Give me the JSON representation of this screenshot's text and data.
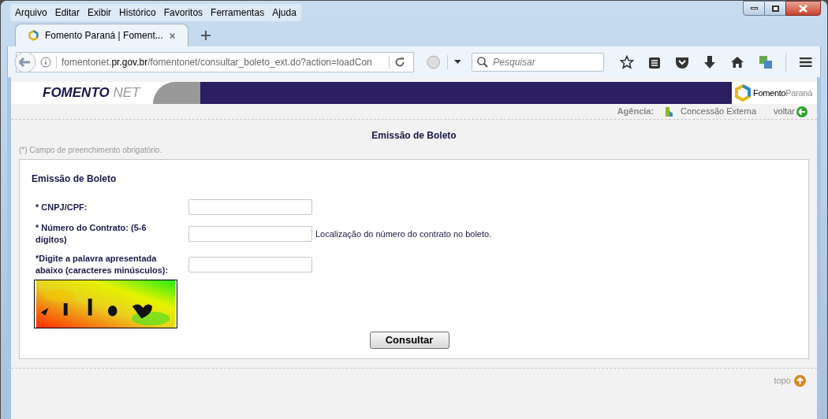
{
  "browser": {
    "menu": [
      "Arquivo",
      "Editar",
      "Exibir",
      "Histórico",
      "Favoritos",
      "Ferramentas",
      "Ajuda"
    ],
    "tab": {
      "title": "Fomento Paraná | Foment...",
      "selected": true
    },
    "url": {
      "host_prefix": "fomentonet.",
      "host": "pr.gov.br",
      "path": "/fomentonet/consultar_boleto_ext.do?action=loadCon"
    },
    "search": {
      "placeholder": "Pesquisar"
    }
  },
  "header": {
    "logo_main": "FOMENTO",
    "logo_sub": "NET",
    "brand_main": "Fomento",
    "brand_sub": "Paraná"
  },
  "agency": {
    "label": "Agência:",
    "value": "Concessão Externa",
    "back": "voltar"
  },
  "page_title": "Emissão de Boleto",
  "required_note": "(*) Campo de preenchimento obrigatório.",
  "form": {
    "title": "Emissão de Boleto",
    "fields": [
      {
        "label": "* CNPJ/CPF:"
      },
      {
        "label": "* Número do Contrato: (5-6 dígitos)",
        "hint": "Localização do número do contrato no boleto."
      },
      {
        "label": "*Digite a palavra apresentada abaixo (caracteres minúsculos):"
      }
    ],
    "submit": "Consultar"
  },
  "footer": {
    "top_link": "topo"
  }
}
